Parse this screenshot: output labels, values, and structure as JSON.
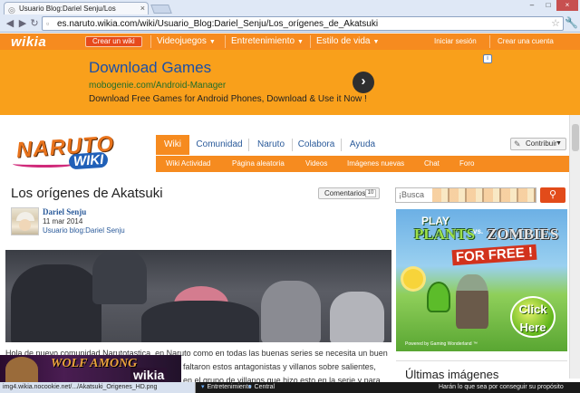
{
  "browser": {
    "tab_title": "Usuario Blog:Dariel Senju/Los",
    "url": "es.naruto.wikia.com/wiki/Usuario_Blog:Dariel_Senju/Los_orígenes_de_Akatsuki"
  },
  "wikia_bar": {
    "logo": "wikia",
    "create_wiki": "Crear un wiki",
    "nav": [
      "Videojuegos",
      "Entretenimiento",
      "Estilo de vida"
    ],
    "login": "Iniciar sesión",
    "signup": "Crear una cuenta"
  },
  "ad": {
    "title": "Download Games",
    "url": "mobogenie.com/Android-Manager",
    "desc": "Download Free Games for Android Phones, Download & Use it Now !"
  },
  "wiki": {
    "logo_main": "NARUTO",
    "logo_sub": "WIKI",
    "tabs": [
      "Wiki",
      "Comunidad",
      "Naruto",
      "Colabora",
      "Ayuda"
    ],
    "subnav": [
      "Wiki Actividad",
      "Página aleatoria",
      "Videos",
      "Imágenes nuevas",
      "Chat",
      "Foro"
    ],
    "contribute": "Contribuir"
  },
  "article": {
    "title": "Los orígenes de Akatsuki",
    "comments_label": "Comentarios",
    "comments_count": "10",
    "author": "Dariel Senju",
    "date": "11 mar 2014",
    "blog_link": "Usuario blog:Dariel Senju",
    "body_line1": "Hola de nuevo comunidad Narutotastica, en Naruto como en todas las buenas series se necesita un buen",
    "body_line2": "faltaron estos antagonistas y villanos sobre salientes,",
    "body_line3": "en el grupo de villanos que hizo esto en la serie y para"
  },
  "rail": {
    "search_placeholder": "¡Busca",
    "ad_play": "PLAY",
    "ad_plants": "PLANTS",
    "ad_vs": "vs.",
    "ad_zombies": "ZOMBIES",
    "ad_free": "FOR FREE !",
    "ad_click": "Click Here",
    "ad_legal": "Powered by Gaming Wonderland ™",
    "latest_title": "Últimas imágenes"
  },
  "bottom": {
    "game_ad": "WOLF AMONG",
    "wikia_badge": "wikia",
    "status_url": "img4.wikia.nocookie.net/.../Akatsuki_Origenes_HD.png",
    "links": [
      "Entretenimiento",
      "Central"
    ],
    "right_text": "Harán lo que sea por conseguir su propósito"
  }
}
